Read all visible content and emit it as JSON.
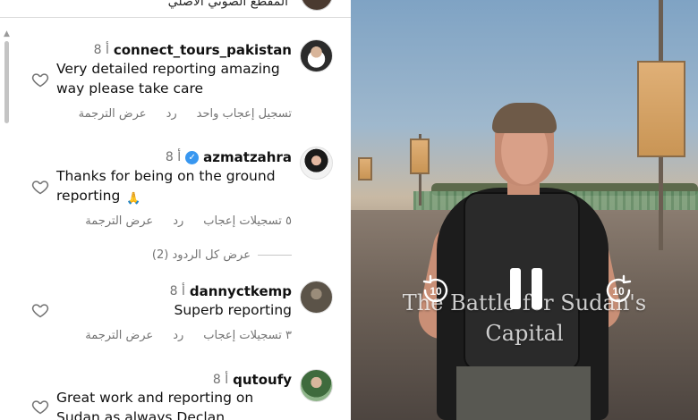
{
  "top": {
    "audio_label": "المقطع الصوتي الأصلي"
  },
  "comments": [
    {
      "username": "connect_tours_pakistan",
      "time": "8 أ",
      "verified": false,
      "text": "Very detailed reporting amazing way please take care",
      "actions": [
        "تسجيل إعجاب واحد",
        "رد",
        "عرض الترجمة"
      ]
    },
    {
      "username": "azmatzahra",
      "time": "8 أ",
      "verified": true,
      "text": "Thanks for being on the ground reporting",
      "emoji": "🙏",
      "actions": [
        "٥ تسجيلات إعجاب",
        "رد",
        "عرض الترجمة"
      ]
    },
    {
      "username": "dannyctkemp",
      "time": "8 أ",
      "verified": false,
      "text": "Superb reporting",
      "actions": [
        "٣ تسجيلات إعجاب",
        "رد",
        "عرض الترجمة"
      ]
    },
    {
      "username": "qutoufy",
      "time": "8 أ",
      "verified": false,
      "text": "Great work and reporting on Sudan as always Declan",
      "actions": []
    }
  ],
  "view_all_replies": "عرض كل الردود (2)",
  "video": {
    "title_line1": "The Battle for Sudan's",
    "title_line2": "Capital",
    "rewind_label": "10",
    "forward_label": "10"
  },
  "colors": {
    "verified_blue": "#3897f0",
    "meta_gray": "#737373"
  }
}
